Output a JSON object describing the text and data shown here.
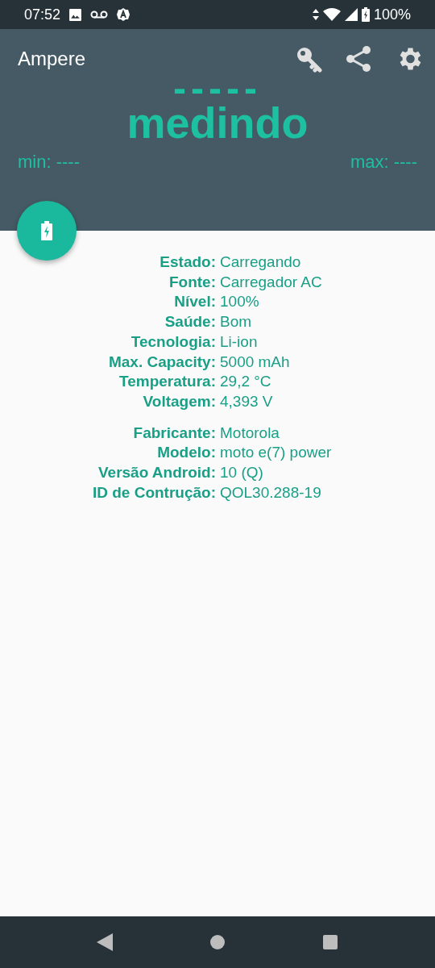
{
  "status_bar": {
    "time": "07:52",
    "battery": "100%"
  },
  "app_bar": {
    "title": "Ampere"
  },
  "meter": {
    "reading": "-----",
    "status": "medindo",
    "min": "min: ----",
    "max": "max: ----"
  },
  "battery_info": [
    {
      "label": "Estado:",
      "value": "Carregando"
    },
    {
      "label": "Fonte:",
      "value": "Carregador AC"
    },
    {
      "label": "Nível:",
      "value": "100%"
    },
    {
      "label": "Saúde:",
      "value": "Bom"
    },
    {
      "label": "Tecnologia:",
      "value": "Li-ion"
    },
    {
      "label": "Max. Capacity:",
      "value": "5000 mAh"
    },
    {
      "label": "Temperatura:",
      "value": "29,2 °C"
    },
    {
      "label": "Voltagem:",
      "value": "4,393 V"
    }
  ],
  "device_info": [
    {
      "label": "Fabricante:",
      "value": "Motorola"
    },
    {
      "label": "Modelo:",
      "value": "moto e(7) power"
    },
    {
      "label": "Versão Android:",
      "value": "10 (Q)"
    },
    {
      "label": "ID de Contrução:",
      "value": "QOL30.288-19"
    }
  ]
}
